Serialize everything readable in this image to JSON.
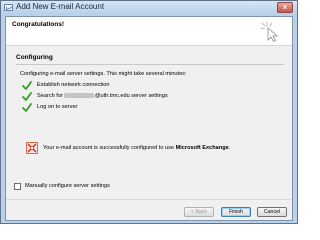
{
  "window": {
    "title": "Add New E-mail Account",
    "close_glyph": "x"
  },
  "header": {
    "title": "Congratulations!",
    "icon": "wizard-cursor-icon"
  },
  "section": {
    "title": "Configuring",
    "intro": "Configuring e-mail server settings. This might take several minutes:"
  },
  "steps": [
    {
      "label": "Establish network connection",
      "status": "done"
    },
    {
      "label_prefix": "Search for",
      "label_suffix": "@uth.tmc.edu server settings",
      "status": "done"
    },
    {
      "label": "Log on to server",
      "status": "done"
    }
  ],
  "result": {
    "icon": "exchange-icon",
    "text": "Your e-mail account is successfully configured to use",
    "bold": "Microsoft Exchange",
    "end": "."
  },
  "manual": {
    "label": "Manually configure server settings",
    "checked": false
  },
  "buttons": {
    "back": "< Back",
    "finish": "Finish",
    "cancel": "Cancel"
  },
  "colors": {
    "check": "#3a9a2a",
    "exchange": "#d9462b"
  }
}
